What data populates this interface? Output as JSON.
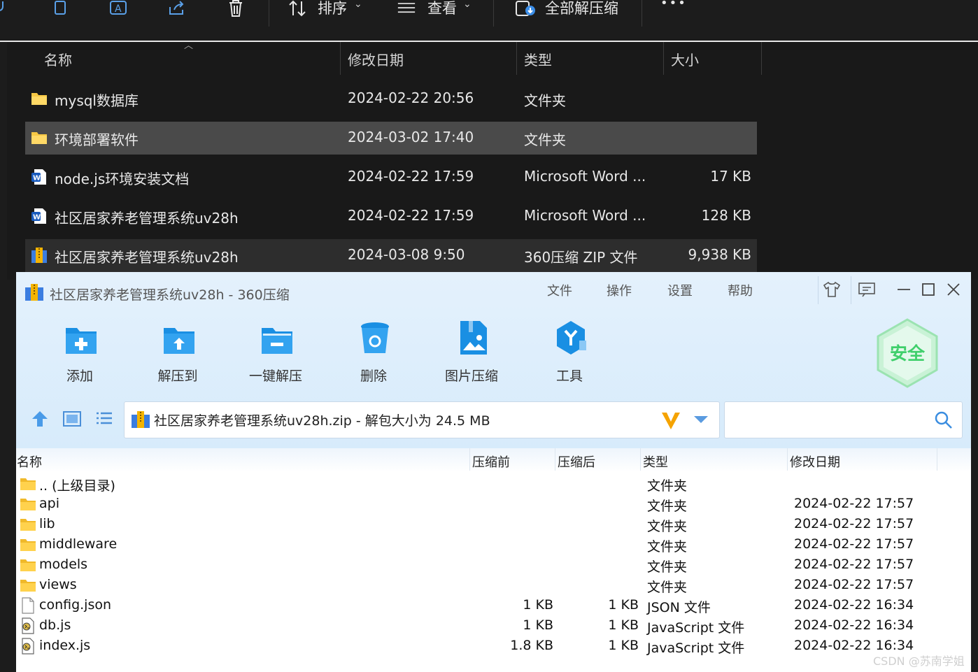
{
  "explorer": {
    "toolbar": {
      "sort_label": "排序",
      "view_label": "查看",
      "extract_all_label": "全部解压缩",
      "more_label": "•••"
    },
    "columns": {
      "name": "名称",
      "modified": "修改日期",
      "type": "类型",
      "size": "大小"
    },
    "rows": [
      {
        "name": "mysql数据库",
        "modified": "2024-02-22 20:56",
        "type": "文件夹",
        "size": "",
        "icon": "folder-icon"
      },
      {
        "name": "环境部署软件",
        "modified": "2024-03-02 17:40",
        "type": "文件夹",
        "size": "",
        "icon": "folder-icon"
      },
      {
        "name": "node.js环境安装文档",
        "modified": "2024-02-22 17:59",
        "type": "Microsoft Word ...",
        "size": "17 KB",
        "icon": "word-doc-icon"
      },
      {
        "name": "社区居家养老管理系统uv28h",
        "modified": "2024-02-22 17:59",
        "type": "Microsoft Word ...",
        "size": "128 KB",
        "icon": "word-doc-icon"
      },
      {
        "name": "社区居家养老管理系统uv28h",
        "modified": "2024-03-08 9:50",
        "type": "360压缩 ZIP 文件",
        "size": "9,938 KB",
        "icon": "zip-archive-icon"
      }
    ]
  },
  "zip": {
    "title": "社区居家养老管理系统uv28h - 360压缩",
    "menu": [
      "文件",
      "操作",
      "设置",
      "帮助"
    ],
    "tools": [
      {
        "label": "添加",
        "icon": "add-folder-icon"
      },
      {
        "label": "解压到",
        "icon": "extract-to-icon"
      },
      {
        "label": "一键解压",
        "icon": "one-click-extract-icon"
      },
      {
        "label": "删除",
        "icon": "delete-bin-icon"
      },
      {
        "label": "图片压缩",
        "icon": "image-compress-icon"
      },
      {
        "label": "工具",
        "icon": "tools-icon"
      }
    ],
    "security_badge": "安全",
    "path": "社区居家养老管理系统uv28h.zip - 解包大小为 24.5 MB",
    "search_placeholder": "",
    "columns": {
      "name": "名称",
      "before": "压缩前",
      "after": "压缩后",
      "type": "类型",
      "modified": "修改日期"
    },
    "rows": [
      {
        "name": ".. (上级目录)",
        "before": "",
        "after": "",
        "type": "文件夹",
        "modified": "",
        "icon": "folder-icon"
      },
      {
        "name": "api",
        "before": "",
        "after": "",
        "type": "文件夹",
        "modified": "2024-02-22 17:57",
        "icon": "folder-icon"
      },
      {
        "name": "lib",
        "before": "",
        "after": "",
        "type": "文件夹",
        "modified": "2024-02-22 17:57",
        "icon": "folder-icon"
      },
      {
        "name": "middleware",
        "before": "",
        "after": "",
        "type": "文件夹",
        "modified": "2024-02-22 17:57",
        "icon": "folder-icon"
      },
      {
        "name": "models",
        "before": "",
        "after": "",
        "type": "文件夹",
        "modified": "2024-02-22 17:57",
        "icon": "folder-icon"
      },
      {
        "name": "views",
        "before": "",
        "after": "",
        "type": "文件夹",
        "modified": "2024-02-22 17:57",
        "icon": "folder-icon"
      },
      {
        "name": "config.json",
        "before": "1 KB",
        "after": "1 KB",
        "type": "JSON 文件",
        "modified": "2024-02-22 16:34",
        "icon": "blank-file-icon"
      },
      {
        "name": "db.js",
        "before": "1 KB",
        "after": "1 KB",
        "type": "JavaScript 文件",
        "modified": "2024-02-22 16:34",
        "icon": "script-file-icon"
      },
      {
        "name": "index.js",
        "before": "1.8 KB",
        "after": "1 KB",
        "type": "JavaScript 文件",
        "modified": "2024-02-22 16:34",
        "icon": "script-file-icon"
      }
    ]
  },
  "watermark": "CSDN @苏南学姐",
  "colors": {
    "explorer_bg": "#1c1c1c",
    "selected_row": "#4a4a4a",
    "zip_header": "#d7ebfb",
    "accent_blue": "#1a8fe3",
    "badge_green": "#3fcf6b"
  }
}
